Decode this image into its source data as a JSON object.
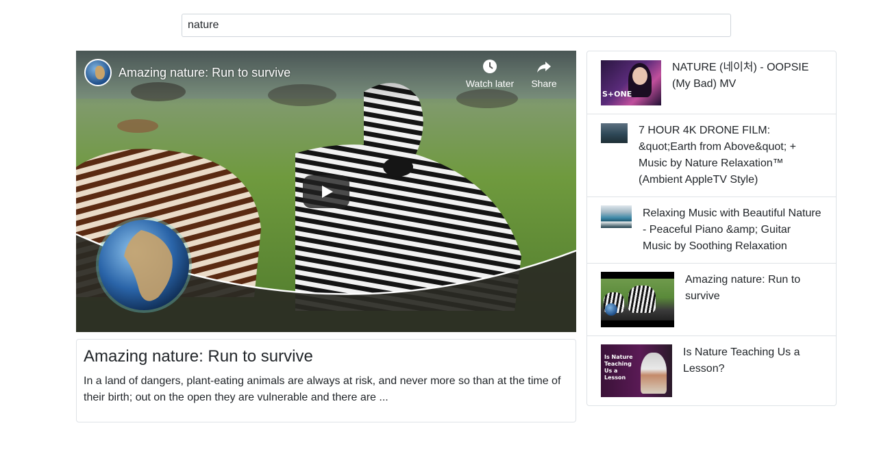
{
  "search": {
    "value": "nature",
    "placeholder": ""
  },
  "player": {
    "title": "Amazing nature: Run to survive",
    "watch_later_label": "Watch later",
    "share_label": "Share"
  },
  "details": {
    "title": "Amazing nature: Run to survive",
    "description": "In a land of dangers, plant-eating animals are always at risk, and never more so than at the time of their birth; out on the open they are vulnerable and there are ..."
  },
  "video_list": [
    {
      "title": "NATURE (네이처) - OOPSIE (My Bad) MV",
      "thumb_text": "S+ONE"
    },
    {
      "title": "7 HOUR 4K DRONE FILM: &quot;Earth from Above&quot; + Music by Nature Relaxation™ (Ambient AppleTV Style)"
    },
    {
      "title": "Relaxing Music with Beautiful Nature - Peaceful Piano &amp; Guitar Music by Soothing Relaxation"
    },
    {
      "title": "Amazing nature: Run to survive"
    },
    {
      "title": "Is Nature Teaching Us a Lesson?",
      "thumb_text": "Is Nature Teaching Us a Lesson"
    }
  ],
  "icons": {
    "watch_later": "clock-icon",
    "share": "share-arrow-icon",
    "play": "play-icon"
  }
}
